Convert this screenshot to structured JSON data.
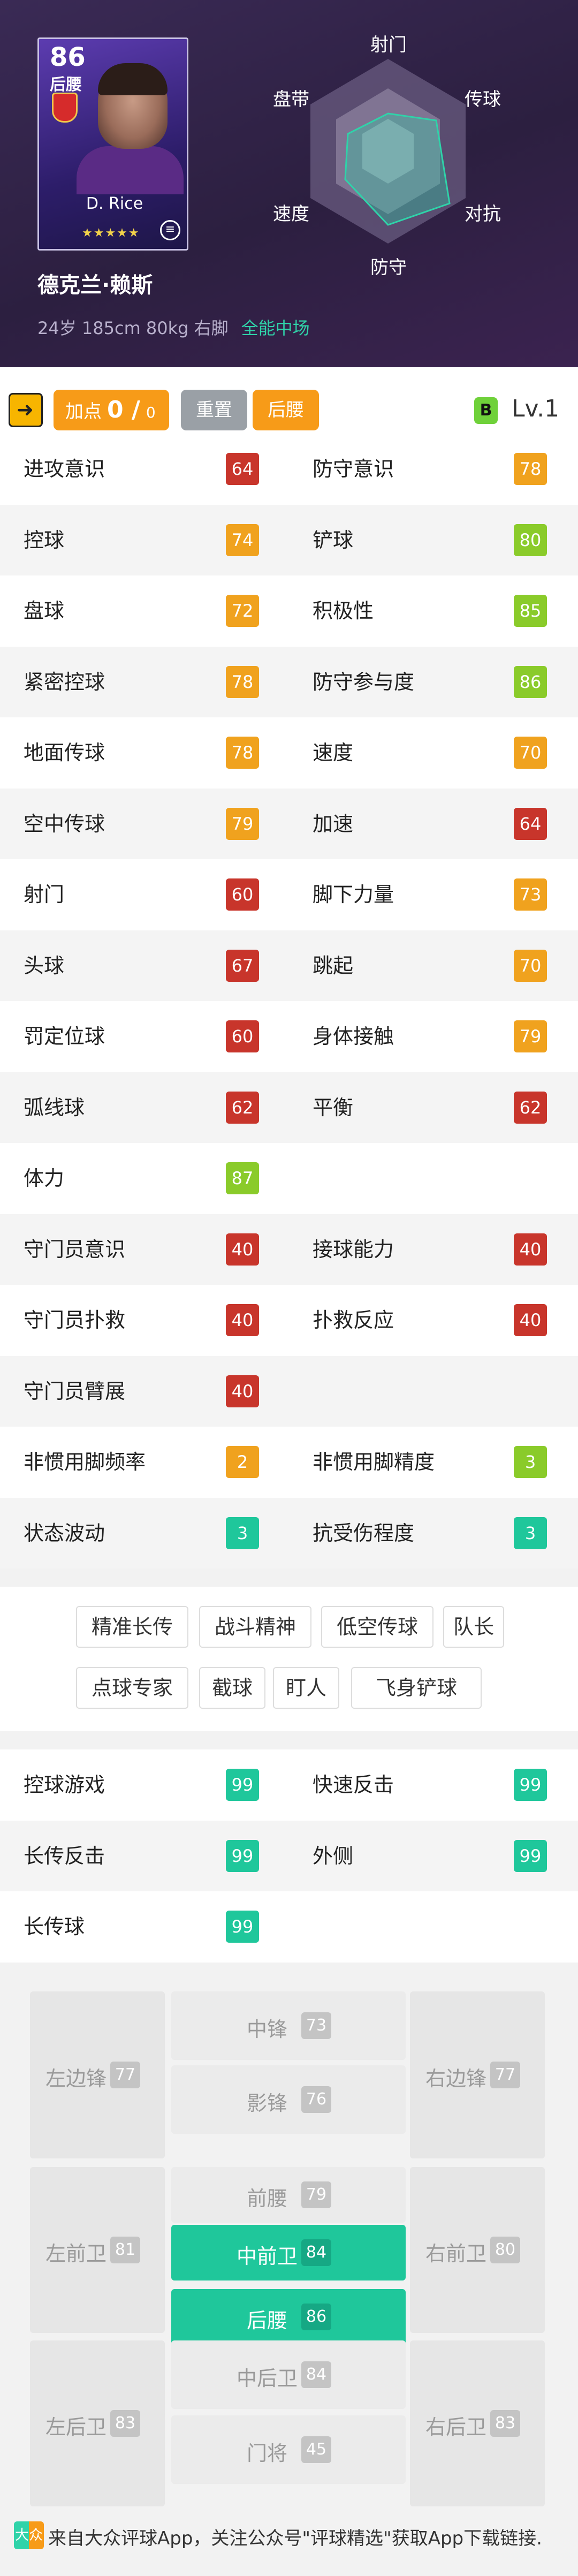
{
  "card": {
    "rating": "86",
    "position": "后腰",
    "name": "D. Rice",
    "stars": "★★★★★"
  },
  "player": {
    "name": "德克兰·赖斯",
    "info": "24岁 185cm 80kg 右脚",
    "role": "全能中场"
  },
  "radar_labels": {
    "top": "射门",
    "top_left": "盘带",
    "top_right": "传球",
    "bottom_left": "速度",
    "bottom_right": "对抗",
    "bottom": "防守"
  },
  "toolbar": {
    "points_label": "加点",
    "points_value": "0 /",
    "points_max": "0",
    "reset": "重置",
    "position": "后腰",
    "level_badge": "B",
    "level": "Lv.1"
  },
  "stats": [
    {
      "l": {
        "label": "进攻意识",
        "value": "64",
        "color": "#c8352b"
      },
      "r": {
        "label": "防守意识",
        "value": "78",
        "color": "#f0a21e"
      }
    },
    {
      "l": {
        "label": "控球",
        "value": "74",
        "color": "#f0a21e"
      },
      "r": {
        "label": "铲球",
        "value": "80",
        "color": "#8acb2a"
      }
    },
    {
      "l": {
        "label": "盘球",
        "value": "72",
        "color": "#f0a21e"
      },
      "r": {
        "label": "积极性",
        "value": "85",
        "color": "#8acb2a"
      }
    },
    {
      "l": {
        "label": "紧密控球",
        "value": "78",
        "color": "#f0a21e"
      },
      "r": {
        "label": "防守参与度",
        "value": "86",
        "color": "#8acb2a"
      }
    },
    {
      "l": {
        "label": "地面传球",
        "value": "78",
        "color": "#f0a21e"
      },
      "r": {
        "label": "速度",
        "value": "70",
        "color": "#f0a21e"
      }
    },
    {
      "l": {
        "label": "空中传球",
        "value": "79",
        "color": "#f0a21e"
      },
      "r": {
        "label": "加速",
        "value": "64",
        "color": "#c8352b"
      }
    },
    {
      "l": {
        "label": "射门",
        "value": "60",
        "color": "#c8352b"
      },
      "r": {
        "label": "脚下力量",
        "value": "73",
        "color": "#f0a21e"
      }
    },
    {
      "l": {
        "label": "头球",
        "value": "67",
        "color": "#c8352b"
      },
      "r": {
        "label": "跳起",
        "value": "70",
        "color": "#f0a21e"
      }
    },
    {
      "l": {
        "label": "罚定位球",
        "value": "60",
        "color": "#c8352b"
      },
      "r": {
        "label": "身体接触",
        "value": "79",
        "color": "#f0a21e"
      }
    },
    {
      "l": {
        "label": "弧线球",
        "value": "62",
        "color": "#c8352b"
      },
      "r": {
        "label": "平衡",
        "value": "62",
        "color": "#c8352b"
      }
    },
    {
      "l": {
        "label": "体力",
        "value": "87",
        "color": "#8acb2a"
      },
      "r": null
    },
    {
      "l": {
        "label": "守门员意识",
        "value": "40",
        "color": "#c8352b"
      },
      "r": {
        "label": "接球能力",
        "value": "40",
        "color": "#c8352b"
      }
    },
    {
      "l": {
        "label": "守门员扑救",
        "value": "40",
        "color": "#c8352b"
      },
      "r": {
        "label": "扑救反应",
        "value": "40",
        "color": "#c8352b"
      }
    },
    {
      "l": {
        "label": "守门员臂展",
        "value": "40",
        "color": "#c8352b"
      },
      "r": null
    },
    {
      "l": {
        "label": "非惯用脚频率",
        "value": "2",
        "color": "#f0a21e"
      },
      "r": {
        "label": "非惯用脚精度",
        "value": "3",
        "color": "#8acb2a"
      }
    },
    {
      "l": {
        "label": "状态波动",
        "value": "3",
        "color": "#1fc79b"
      },
      "r": {
        "label": "抗受伤程度",
        "value": "3",
        "color": "#1fc79b"
      }
    }
  ],
  "skills": [
    "精准长传",
    "战斗精神",
    "低空传球",
    "队长",
    "点球专家",
    "截球",
    "盯人",
    "飞身铲球"
  ],
  "ai_skills": [
    {
      "l": {
        "label": "控球游戏",
        "value": "99"
      },
      "r": {
        "label": "快速反击",
        "value": "99"
      }
    },
    {
      "l": {
        "label": "长传反击",
        "value": "99"
      },
      "r": {
        "label": "外侧",
        "value": "99"
      }
    },
    {
      "l": {
        "label": "长传球",
        "value": "99"
      },
      "r": null
    }
  ],
  "positions": {
    "lw": {
      "label": "左边锋",
      "value": "77"
    },
    "cf": {
      "label": "中锋",
      "value": "73"
    },
    "rw": {
      "label": "右边锋",
      "value": "77"
    },
    "ss": {
      "label": "影锋",
      "value": "76"
    },
    "amf": {
      "label": "前腰",
      "value": "79"
    },
    "lmf": {
      "label": "左前卫",
      "value": "81"
    },
    "cmf": {
      "label": "中前卫",
      "value": "84"
    },
    "rmf": {
      "label": "右前卫",
      "value": "80"
    },
    "dmf": {
      "label": "后腰",
      "value": "86"
    },
    "lb": {
      "label": "左后卫",
      "value": "83"
    },
    "cb": {
      "label": "中后卫",
      "value": "84"
    },
    "rb": {
      "label": "右后卫",
      "value": "83"
    },
    "gk": {
      "label": "门将",
      "value": "45"
    }
  },
  "colors": {
    "ai_green": "#1fc79b",
    "active_pos": "#1fc79b"
  },
  "footer": {
    "logo": "大众",
    "text": "来自大众评球App，关注公众号\"评球精选\"获取App下载链接."
  }
}
